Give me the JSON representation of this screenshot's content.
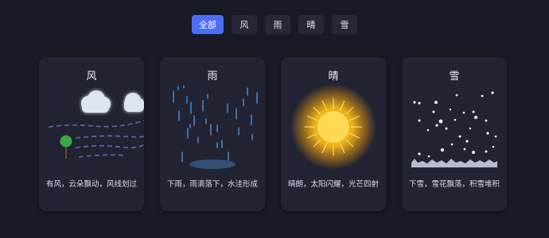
{
  "filter_tabs": [
    {
      "label": "全部",
      "active": true
    },
    {
      "label": "风",
      "active": false
    },
    {
      "label": "雨",
      "active": false
    },
    {
      "label": "晴",
      "active": false
    },
    {
      "label": "雪",
      "active": false
    }
  ],
  "cards": [
    {
      "title": "风",
      "description": "有风，云朵飘动，风线划过",
      "icon": "wind-scene"
    },
    {
      "title": "雨",
      "description": "下雨，雨滴落下，水洼形成",
      "icon": "rain-scene"
    },
    {
      "title": "晴",
      "description": "晴朗，太阳闪耀，光芒四射",
      "icon": "sun-scene"
    },
    {
      "title": "雪",
      "description": "下雪，雪花飘落，积雪堆积",
      "icon": "snow-scene"
    }
  ],
  "colors": {
    "background": "#181a25",
    "card": "#222433",
    "tab": "#262838",
    "tab_active": "#4c6ef5",
    "rain": "#4a90d9",
    "sun": "#ffc21a",
    "tree": "#3aa84a"
  }
}
